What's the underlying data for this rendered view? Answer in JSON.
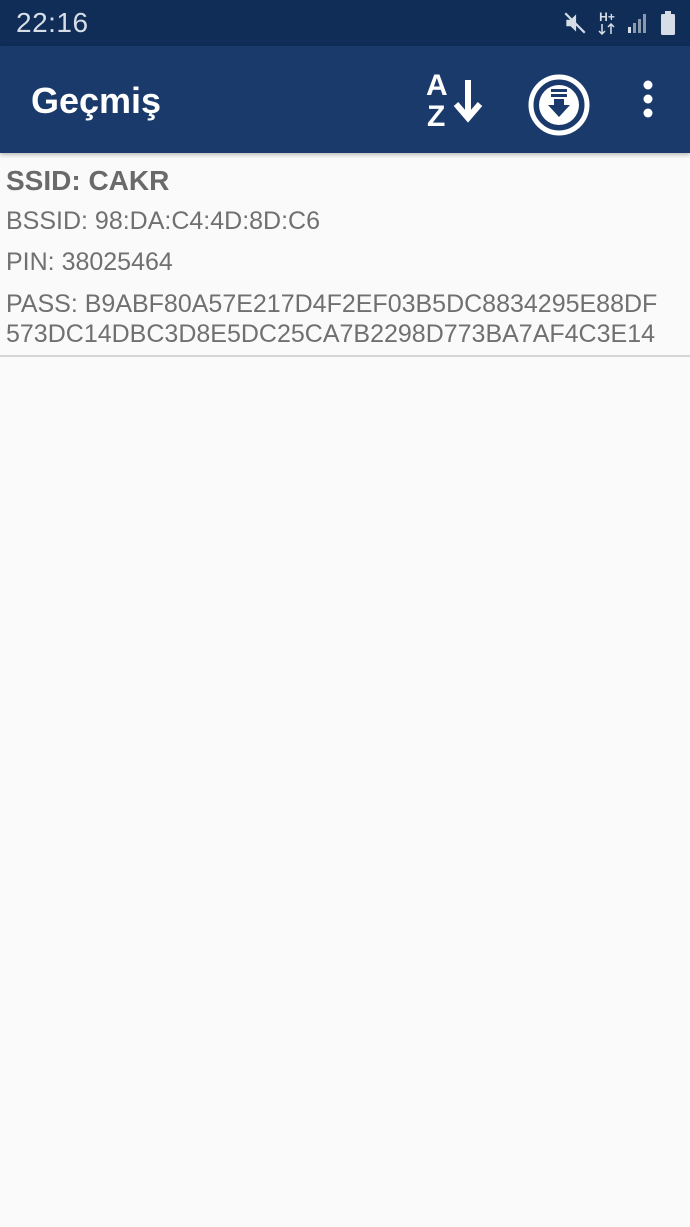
{
  "status_bar": {
    "time": "22:16",
    "network_type": "H+",
    "icons": [
      "mute-icon",
      "network-type-icon",
      "signal-icon",
      "battery-icon"
    ]
  },
  "app_bar": {
    "title": "Geçmiş",
    "actions": [
      "sort-az-icon",
      "download-icon",
      "more-vert-icon"
    ],
    "sort_letters": {
      "top": "A",
      "bottom": "Z"
    }
  },
  "history": {
    "items": [
      {
        "ssid": "SSID: CAKR",
        "bssid": "BSSID: 98:DA:C4:4D:8D:C6",
        "pin": "PIN: 38025464",
        "pass_line1": "PASS: B9ABF80A57E217D4F2EF03B5DC8834295E88DF",
        "pass_line2": "573DC14DBC3D8E5DC25CA7B2298D773BA7AF4C3E14"
      }
    ]
  },
  "colors": {
    "status_bar": "#0f2d57",
    "app_bar": "#1a3a6b",
    "background": "#fafafa",
    "text": "#707070"
  }
}
